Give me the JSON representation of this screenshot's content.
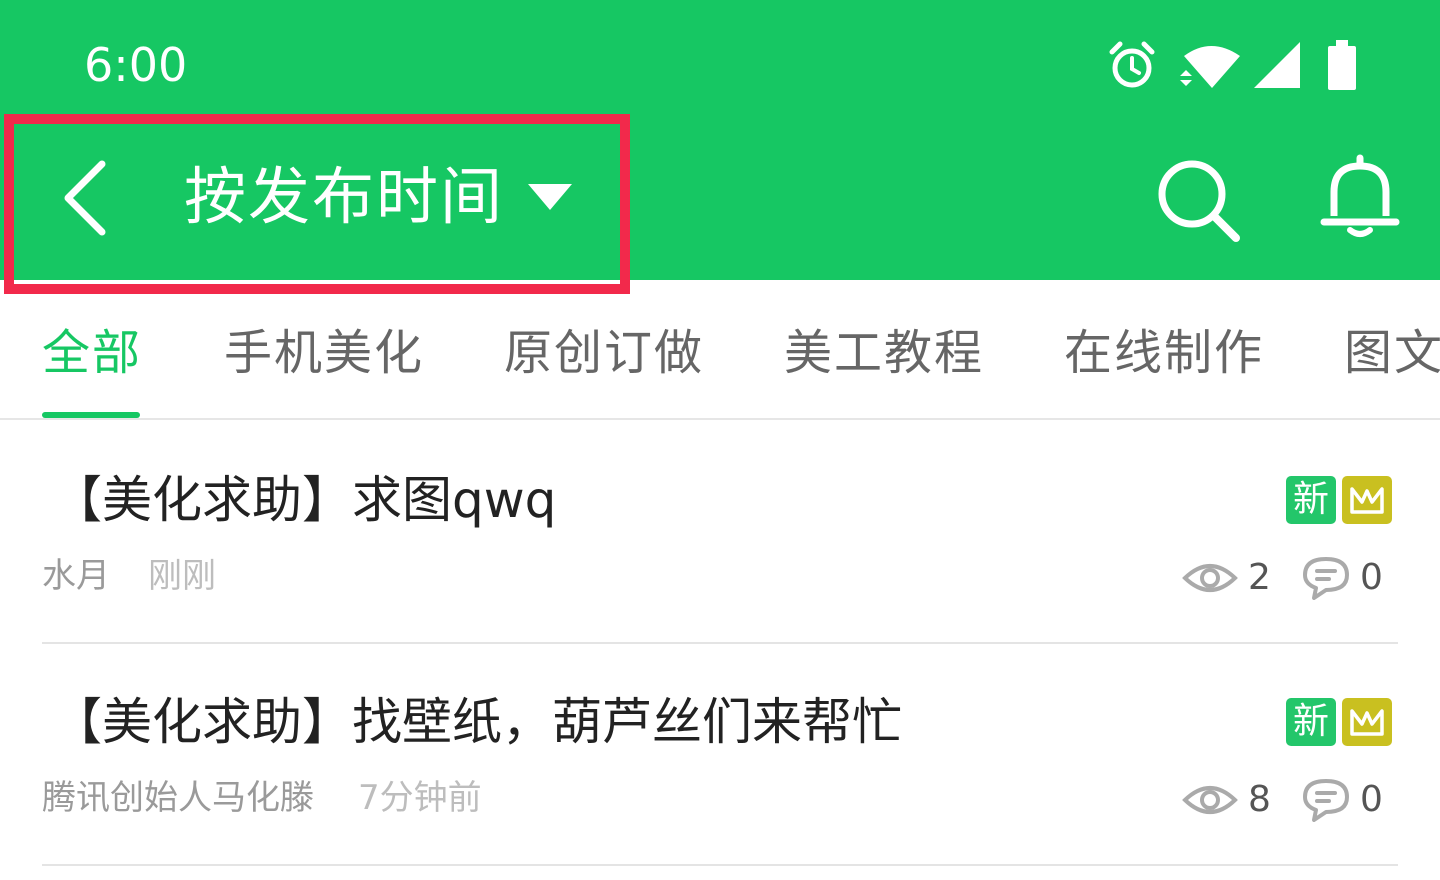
{
  "status_bar": {
    "time": "6:00"
  },
  "toolbar": {
    "sort_label": "按发布时间"
  },
  "tabs": [
    {
      "label": "全部",
      "active": true
    },
    {
      "label": "手机美化",
      "active": false
    },
    {
      "label": "原创订做",
      "active": false
    },
    {
      "label": "美工教程",
      "active": false
    },
    {
      "label": "在线制作",
      "active": false
    },
    {
      "label": "图文",
      "active": false
    }
  ],
  "posts": [
    {
      "title": "【美化求助】求图qwq",
      "author": "水月",
      "time": "刚刚",
      "badge_new": "新",
      "views": "2",
      "comments": "0"
    },
    {
      "title": "【美化求助】找壁纸，葫芦丝们来帮忙",
      "author": "腾讯创始人马化滕",
      "time": "7分钟前",
      "badge_new": "新",
      "views": "8",
      "comments": "0"
    }
  ],
  "colors": {
    "primary": "#16c763",
    "highlight": "#f2294b",
    "badge_new": "#23c66a",
    "badge_crown": "#c9c020"
  },
  "icons": [
    "alarm-icon",
    "wifi-icon",
    "signal-icon",
    "battery-icon",
    "back-arrow-icon",
    "dropdown-caret-icon",
    "search-icon",
    "bell-icon",
    "crown-icon",
    "eye-icon",
    "comment-icon"
  ]
}
